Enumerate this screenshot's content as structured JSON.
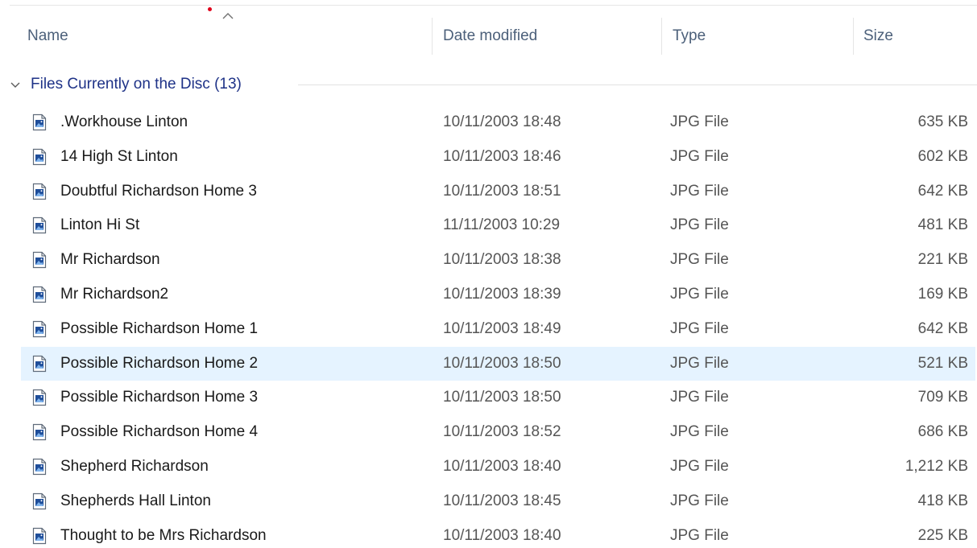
{
  "columns": {
    "name": "Name",
    "date_modified": "Date modified",
    "type": "Type",
    "size": "Size"
  },
  "sort": {
    "column": "name",
    "direction": "ascending"
  },
  "group": {
    "label": "Files Currently on the Disc (13)",
    "expanded": true
  },
  "files": [
    {
      "name": ".Workhouse Linton",
      "date": "10/11/2003 18:48",
      "type": "JPG File",
      "size": "635 KB"
    },
    {
      "name": "14 High St Linton",
      "date": "10/11/2003 18:46",
      "type": "JPG File",
      "size": "602 KB"
    },
    {
      "name": "Doubtful Richardson Home  3",
      "date": "10/11/2003 18:51",
      "type": "JPG File",
      "size": "642 KB"
    },
    {
      "name": "Linton Hi St",
      "date": "11/11/2003 10:29",
      "type": "JPG File",
      "size": "481 KB"
    },
    {
      "name": "Mr Richardson",
      "date": "10/11/2003 18:38",
      "type": "JPG File",
      "size": "221 KB"
    },
    {
      "name": "Mr Richardson2",
      "date": "10/11/2003 18:39",
      "type": "JPG File",
      "size": "169 KB"
    },
    {
      "name": "Possible Richardson Home 1",
      "date": "10/11/2003 18:49",
      "type": "JPG File",
      "size": "642 KB"
    },
    {
      "name": "Possible Richardson Home 2",
      "date": "10/11/2003 18:50",
      "type": "JPG File",
      "size": "521 KB"
    },
    {
      "name": "Possible Richardson Home 3",
      "date": "10/11/2003 18:50",
      "type": "JPG File",
      "size": "709 KB"
    },
    {
      "name": "Possible Richardson Home 4",
      "date": "10/11/2003 18:52",
      "type": "JPG File",
      "size": "686 KB"
    },
    {
      "name": "Shepherd Richardson",
      "date": "10/11/2003 18:40",
      "type": "JPG File",
      "size": "1,212 KB"
    },
    {
      "name": "Shepherds Hall Linton",
      "date": "10/11/2003 18:45",
      "type": "JPG File",
      "size": "418 KB"
    },
    {
      "name": "Thought to be Mrs Richardson",
      "date": "10/11/2003 18:40",
      "type": "JPG File",
      "size": "225 KB"
    }
  ],
  "selected_index": 7,
  "icons": {
    "file": "image-file-icon",
    "sort": "sort-ascending-icon",
    "group": "chevron-down-icon"
  },
  "colors": {
    "selection": "#e5f3ff",
    "group_label": "#1e3287",
    "header_text": "#4c607a",
    "indicator_dot": "#e0001b"
  }
}
